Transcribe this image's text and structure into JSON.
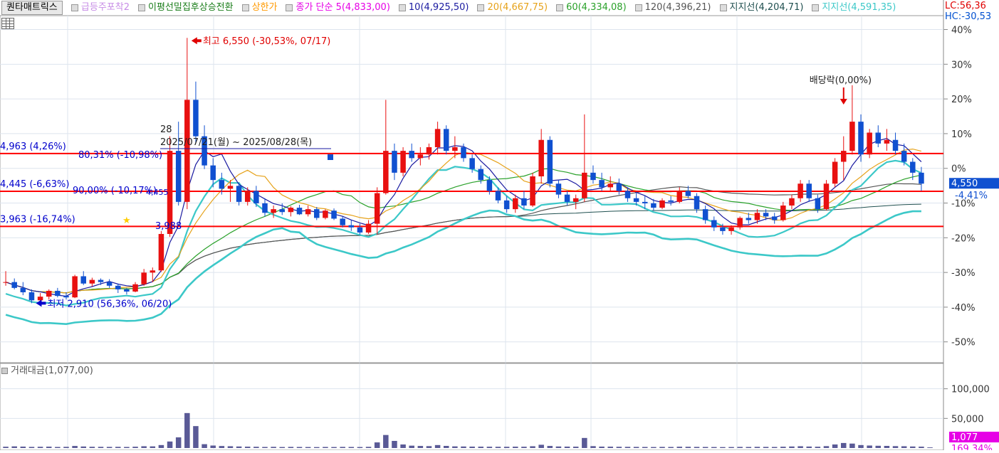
{
  "legend": {
    "title": "퀀타매트릭스",
    "items": [
      {
        "label": "급등주포착2",
        "color": "#c78ce6"
      },
      {
        "label": "이평선밀집후상승전환",
        "color": "#1a7d1a"
      },
      {
        "label": "상한가",
        "color": "#ff9900"
      },
      {
        "label": "종가 단순 5(4,833,00)",
        "color": "#e600e6"
      },
      {
        "label": "10(4,925,50)",
        "color": "#1a1aa0"
      },
      {
        "label": "20(4,667,75)",
        "color": "#e6a21a"
      },
      {
        "label": "60(4,334,08)",
        "color": "#2aa12a"
      },
      {
        "label": "120(4,396,21)",
        "color": "#555555"
      },
      {
        "label": "지지선(4,204,71)",
        "color": "#1f4f4f"
      },
      {
        "label": "지지선(4,591,35)",
        "color": "#3cc8c8"
      }
    ]
  },
  "lc_label": "LC:56,36",
  "hc_label": "HC:-30,53",
  "annotations": {
    "high": "최고 6,550 (-30,53%, 07/17)",
    "low": "최저 2,910 (56,36%, 06/20)",
    "dividend": "배당락(0,00%)",
    "range": "2025/07/21(월) ~ 2025/08/28(목)",
    "period_count": "28",
    "level_high_pct": "80,31% (-10,98%)",
    "level_mid_pct": "90,00% (-10,17%)",
    "star_price": "3,988",
    "mid_small": "4,455"
  },
  "levels": [
    {
      "label": "4,963 (4,26%)",
      "value": 4963,
      "color": "#0000cc"
    },
    {
      "label": "4,445 (-6,63%)",
      "value": 4445,
      "color": "#0000cc"
    },
    {
      "label": "3,963 (-16,74%)",
      "value": 3963,
      "color": "#0000cc"
    }
  ],
  "current_price": {
    "label": "4,550",
    "pct": "-4,41%",
    "value": 4550
  },
  "volume": {
    "legend": "거래대금(1,077,00)",
    "current_label": "1,077",
    "current_pct": "169,34%"
  },
  "chart_data": {
    "type": "candlestick",
    "base_price": 4760,
    "y_pct_ticks": [
      "40%",
      "30%",
      "20%",
      "10%",
      "0%",
      "-10%",
      "-20%",
      "-30%",
      "-40%",
      "-50%"
    ],
    "y_pct_values": [
      40,
      30,
      20,
      10,
      0,
      -10,
      -20,
      -30,
      -40,
      -50
    ],
    "ylim_pct": [
      -56,
      44
    ],
    "volume_ticks": [
      "100,000",
      "50,000"
    ],
    "volume_tick_values": [
      100000,
      50000
    ],
    "volume_ylim": [
      0,
      120000
    ],
    "candles": [
      [
        3200,
        3350,
        3150,
        3200
      ],
      [
        3200,
        3250,
        3100,
        3120
      ],
      [
        3120,
        3200,
        3020,
        3060
      ],
      [
        3060,
        3100,
        2910,
        2950
      ],
      [
        2950,
        3050,
        2940,
        3000
      ],
      [
        3000,
        3100,
        2960,
        3080
      ],
      [
        3080,
        3120,
        2990,
        3010
      ],
      [
        3010,
        3060,
        2960,
        2990
      ],
      [
        2990,
        3300,
        2980,
        3280
      ],
      [
        3280,
        3350,
        3160,
        3180
      ],
      [
        3180,
        3260,
        3140,
        3230
      ],
      [
        3230,
        3250,
        3160,
        3200
      ],
      [
        3200,
        3240,
        3120,
        3150
      ],
      [
        3150,
        3180,
        3050,
        3100
      ],
      [
        3100,
        3120,
        3030,
        3070
      ],
      [
        3070,
        3200,
        3060,
        3170
      ],
      [
        3170,
        3380,
        3150,
        3330
      ],
      [
        3330,
        3400,
        3200,
        3360
      ],
      [
        3360,
        3900,
        3340,
        3860
      ],
      [
        3860,
        5200,
        3820,
        5000
      ],
      [
        5000,
        5400,
        4250,
        4300
      ],
      [
        4300,
        6550,
        4200,
        5700
      ],
      [
        5700,
        5950,
        5100,
        5200
      ],
      [
        5200,
        5350,
        4750,
        4800
      ],
      [
        4800,
        4900,
        4500,
        4600
      ],
      [
        4600,
        4700,
        4400,
        4480
      ],
      [
        4480,
        4600,
        4300,
        4520
      ],
      [
        4520,
        4560,
        4250,
        4300
      ],
      [
        4300,
        4500,
        4250,
        4450
      ],
      [
        4450,
        4520,
        4230,
        4280
      ],
      [
        4280,
        4350,
        4100,
        4150
      ],
      [
        4150,
        4250,
        4080,
        4200
      ],
      [
        4200,
        4280,
        4120,
        4160
      ],
      [
        4160,
        4240,
        4100,
        4220
      ],
      [
        4220,
        4260,
        4120,
        4130
      ],
      [
        4130,
        4250,
        4100,
        4200
      ],
      [
        4200,
        4230,
        4050,
        4080
      ],
      [
        4080,
        4200,
        4060,
        4180
      ],
      [
        4180,
        4210,
        4050,
        4070
      ],
      [
        4070,
        4100,
        3950,
        3980
      ],
      [
        3980,
        4050,
        3900,
        3950
      ],
      [
        3950,
        4000,
        3850,
        3880
      ],
      [
        3880,
        4050,
        3860,
        4000
      ],
      [
        4000,
        4500,
        3850,
        4420
      ],
      [
        4420,
        5700,
        4400,
        5000
      ],
      [
        5000,
        5100,
        4600,
        4700
      ],
      [
        4700,
        5050,
        4650,
        5000
      ],
      [
        5000,
        5100,
        4850,
        4900
      ],
      [
        4900,
        5050,
        4800,
        4950
      ],
      [
        4950,
        5100,
        4880,
        5050
      ],
      [
        5050,
        5400,
        4950,
        5300
      ],
      [
        5300,
        5350,
        4950,
        5000
      ],
      [
        5000,
        5200,
        4900,
        5050
      ],
      [
        5050,
        5100,
        4850,
        4900
      ],
      [
        4900,
        4950,
        4700,
        4750
      ],
      [
        4750,
        4800,
        4550,
        4600
      ],
      [
        4600,
        4650,
        4400,
        4450
      ],
      [
        4450,
        4500,
        4280,
        4320
      ],
      [
        4320,
        4380,
        4150,
        4200
      ],
      [
        4200,
        4400,
        4150,
        4350
      ],
      [
        4350,
        4450,
        4200,
        4250
      ],
      [
        4250,
        4700,
        4230,
        4650
      ],
      [
        4650,
        5300,
        4550,
        5150
      ],
      [
        5150,
        5200,
        4500,
        4550
      ],
      [
        4550,
        4600,
        4350,
        4400
      ],
      [
        4400,
        4450,
        4250,
        4300
      ],
      [
        4300,
        4400,
        4200,
        4350
      ],
      [
        4350,
        5500,
        4300,
        4700
      ],
      [
        4700,
        4800,
        4550,
        4600
      ],
      [
        4600,
        4700,
        4450,
        4500
      ],
      [
        4500,
        4650,
        4450,
        4550
      ],
      [
        4550,
        4620,
        4400,
        4450
      ],
      [
        4450,
        4500,
        4300,
        4350
      ],
      [
        4350,
        4420,
        4250,
        4300
      ],
      [
        4300,
        4380,
        4200,
        4280
      ],
      [
        4280,
        4340,
        4180,
        4220
      ],
      [
        4220,
        4350,
        4200,
        4320
      ],
      [
        4320,
        4380,
        4250,
        4300
      ],
      [
        4300,
        4500,
        4280,
        4450
      ],
      [
        4450,
        4520,
        4350,
        4380
      ],
      [
        4380,
        4420,
        4150,
        4200
      ],
      [
        4200,
        4250,
        4000,
        4050
      ],
      [
        4050,
        4100,
        3900,
        3950
      ],
      [
        3950,
        4000,
        3850,
        3900
      ],
      [
        3900,
        3980,
        3850,
        3950
      ],
      [
        3950,
        4100,
        3920,
        4080
      ],
      [
        4080,
        4150,
        4000,
        4050
      ],
      [
        4050,
        4200,
        4000,
        4150
      ],
      [
        4150,
        4200,
        4050,
        4100
      ],
      [
        4100,
        4150,
        4000,
        4050
      ],
      [
        4050,
        4300,
        4030,
        4250
      ],
      [
        4250,
        4400,
        4200,
        4350
      ],
      [
        4350,
        4600,
        4300,
        4550
      ],
      [
        4550,
        4600,
        4300,
        4350
      ],
      [
        4350,
        4400,
        4150,
        4200
      ],
      [
        4200,
        4600,
        4180,
        4550
      ],
      [
        4550,
        4900,
        4500,
        4850
      ],
      [
        4850,
        5200,
        4600,
        5000
      ],
      [
        5000,
        5900,
        4950,
        5400
      ],
      [
        5400,
        5500,
        4850,
        4950
      ],
      [
        4950,
        5300,
        4900,
        5250
      ],
      [
        5250,
        5350,
        5050,
        5100
      ],
      [
        5100,
        5300,
        5000,
        5150
      ],
      [
        5150,
        5250,
        4950,
        5000
      ],
      [
        5000,
        5100,
        4800,
        4850
      ],
      [
        4850,
        4900,
        4600,
        4700
      ],
      [
        4700,
        4780,
        4450,
        4550
      ]
    ],
    "volume": [
      2200,
      2800,
      2400,
      1900,
      2100,
      2300,
      1800,
      2000,
      3500,
      2600,
      2100,
      2000,
      1900,
      2000,
      1800,
      2200,
      3000,
      2800,
      5000,
      11000,
      18000,
      59000,
      37000,
      6500,
      4200,
      3400,
      3000,
      2600,
      2300,
      2100,
      1800,
      2000,
      1700,
      1900,
      1800,
      1700,
      1600,
      1800,
      1700,
      1900,
      1800,
      1700,
      2000,
      9500,
      22000,
      12000,
      6000,
      4000,
      3500,
      3200,
      5000,
      3600,
      2800,
      2600,
      2400,
      2300,
      2200,
      2100,
      2100,
      2300,
      2200,
      3000,
      5500,
      3500,
      2600,
      2400,
      2300,
      17000,
      3200,
      2400,
      2300,
      2100,
      2000,
      1900,
      1800,
      1700,
      1900,
      1800,
      2200,
      2100,
      1900,
      1800,
      1700,
      1600,
      1700,
      1900,
      1800,
      2000,
      1900,
      1800,
      2200,
      2600,
      3000,
      2500,
      2200,
      3200,
      6000,
      8500,
      7500,
      5000,
      4200,
      3800,
      3600,
      3200,
      3000,
      2600,
      2300,
      1077
    ]
  }
}
